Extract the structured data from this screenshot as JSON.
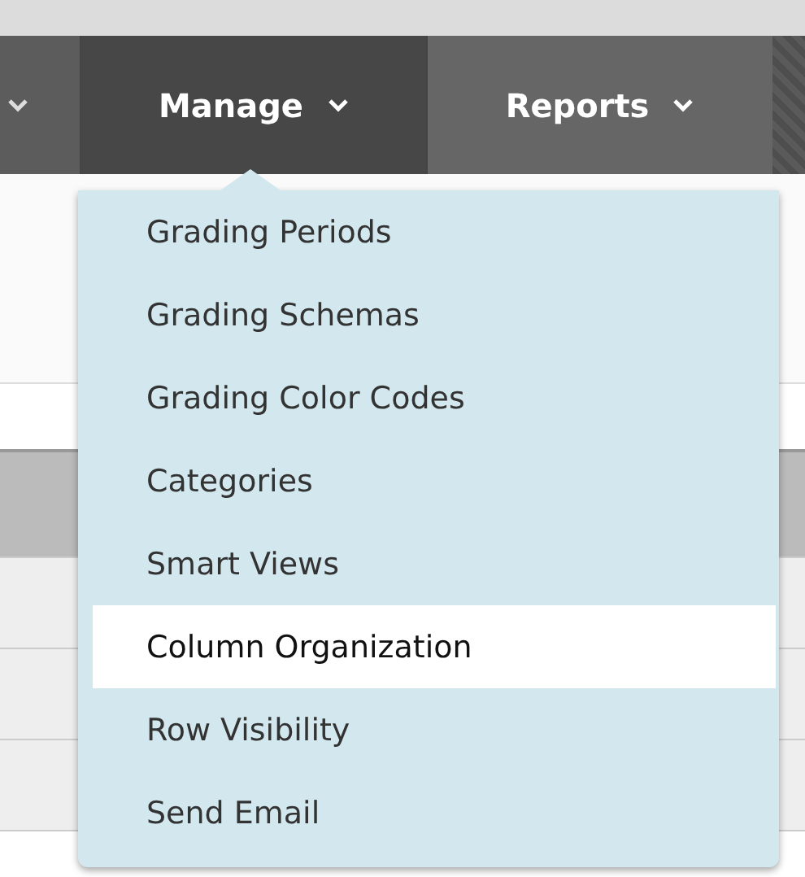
{
  "nav": [
    {
      "label": "Manage",
      "selected": true
    },
    {
      "label": "Reports",
      "selected": false
    }
  ],
  "menu": {
    "items": [
      {
        "label": "Grading Periods",
        "selected": false
      },
      {
        "label": "Grading Schemas",
        "selected": false
      },
      {
        "label": "Grading Color Codes",
        "selected": false
      },
      {
        "label": "Categories",
        "selected": false
      },
      {
        "label": "Smart Views",
        "selected": false
      },
      {
        "label": "Column Organization",
        "selected": true
      },
      {
        "label": "Row Visibility",
        "selected": false
      },
      {
        "label": "Send Email",
        "selected": false
      }
    ]
  }
}
